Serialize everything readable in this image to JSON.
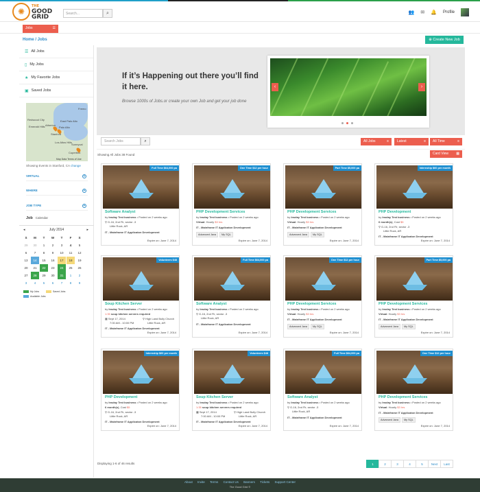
{
  "logo": {
    "the": "THE",
    "good": "GOOD",
    "grid": "GRID"
  },
  "header": {
    "search_placeholder": "Search...",
    "profile_label": "Profile",
    "icons": [
      "users-icon",
      "envelope-icon",
      "bell-icon"
    ]
  },
  "subbar": {
    "jobs_dropdown": "Jobs"
  },
  "breadcrumb": "Home / Jobs",
  "create_button": "Create New Job",
  "sidebar": {
    "nav": [
      {
        "label": "All Jobs",
        "icon": "list-icon"
      },
      {
        "label": "My Jobs",
        "icon": "file-icon"
      },
      {
        "label": "My Favorite Jobs",
        "icon": "star-icon"
      },
      {
        "label": "Saved Jobs",
        "icon": "save-icon"
      }
    ],
    "map_cities": [
      "Redwood City",
      "Palo Alto",
      "Stanford",
      "Los Altos Hills",
      "Sunnyval",
      "Cupertino",
      "East Palo Alto",
      "Atherton",
      "Emerald Hills",
      "Fremo"
    ],
    "map_credit": "Map Data   Terms of Use",
    "showing_text": "Showing Events in Stanford, CA",
    "change_link": "change",
    "filters": [
      "VIRTUAL",
      "WHERE",
      "JOB TYPE"
    ],
    "job_label": "Job",
    "calendar_tab": "Calendar",
    "calendar": {
      "month": "July 2014",
      "days": [
        "S",
        "M",
        "T",
        "W",
        "T",
        "F",
        "S"
      ],
      "weeks": [
        [
          "29",
          "30",
          "1",
          "2",
          "3",
          "4",
          "5"
        ],
        [
          "6",
          "7",
          "8",
          "9",
          "10",
          "11",
          "12"
        ],
        [
          "13",
          "14",
          "15",
          "16",
          "17",
          "18",
          "19"
        ],
        [
          "20",
          "21",
          "22",
          "23",
          "24",
          "25",
          "26"
        ],
        [
          "27",
          "28",
          "29",
          "30",
          "31",
          "1",
          "2"
        ],
        [
          "3",
          "4",
          "5",
          "6",
          "7",
          "8",
          "9"
        ]
      ],
      "legend": [
        "My Jobs",
        "Saved Jobs",
        "Available Jobs"
      ],
      "colors": {
        "my_jobs": "#3ba54a",
        "saved_jobs": "#f5d97a",
        "available_jobs": "#5aa9db"
      }
    }
  },
  "hero": {
    "heading": "If it’s Happening out there you’ll find it here.",
    "subtext": "Browse 1000s of Jobs.or create your own Job and get your job done"
  },
  "controls": {
    "search_placeholder": "Search Jobs",
    "all_jobs": "All Jobs",
    "latest": "Latest",
    "all_time": "All Time",
    "count_text": "Showing All Jobs   38 Found",
    "card_view": "Card View"
  },
  "cards": [
    {
      "ribbon": "Full Time $64,000 pa",
      "title": "Software Analyst",
      "business": "Insday Test business",
      "posted": "Posted on 2 weeks ago",
      "l1": "G-16, 2nd Flr, sector -3",
      "l2": "Little Rock, AR",
      "skills": "IT - Mainframe   IT Applicaton Development",
      "expire": "Expire on: June 7, 2014"
    },
    {
      "ribbon": "One Time $12 per hour",
      "title": "PHP Development Services",
      "business": "Insday Test business",
      "posted": "Posted on 2 weeks ago",
      "l1": "Virtual",
      "l1b": "Hourly",
      "l1c": "$3 hrs",
      "skills": "IT - Mainframe   IT Applicaton Development",
      "tags": [
        "Advanced Java",
        "My SQL"
      ],
      "expire": "Expire on: June 7, 2014"
    },
    {
      "ribbon": "Part Time $5,000 pa",
      "title": "PHP Development Services",
      "business": "Insday Test business",
      "posted": "Posted on 2 weeks ago",
      "l1": "Virtual",
      "l1b": "Hourly",
      "l1c": "$3 hrs",
      "skills": "IT - Mainframe   IT Applicaton Development",
      "tags": [
        "Advanced Java",
        "My SQL"
      ],
      "expire": "Expire on: June 7, 2014"
    },
    {
      "ribbon": "Internship $60 per month",
      "title": "PHP Development",
      "business": "Insday Test business",
      "posted": "Posted on 2 weeks ago",
      "l1": "6 month(s)",
      "l1b": "Cost",
      "l1c": "$5",
      "l2": "G-16, 2nd Flr, sector -3",
      "l3": "Little Rock, AR",
      "skills": "IT - Mainframe   IT Applicaton Development",
      "expire": "Expire on: June 7, 2014"
    },
    {
      "ribbon": "Volunteers  $48",
      "title": "Soup Kitchen Server",
      "business": "Insday Test business",
      "posted": "Posted on 2 weeks ago",
      "l1": "1:35",
      "l1b": "soup kitchen servers required",
      "d1": "Sept 17, 2014",
      "d2": "7:00 AM - 10:00 PM",
      "p1": "High Land Bully Church",
      "p2": "Little Rock, AR",
      "skills": "IT - Mainframe   IT Applicaton Development",
      "expire": "Expire on: June 7, 2014"
    },
    {
      "ribbon": "Full Time $64,000 pa",
      "title": "Software Analyst",
      "business": "Insday Test business",
      "posted": "Posted on 2 weeks ago",
      "l1": "G-16, 2nd Flr, sector -3",
      "l2": "Little Rock, AR",
      "skills": "IT - Mainframe   IT Applicaton Development",
      "expire": "Expire on: June 7, 2014"
    },
    {
      "ribbon": "One Time $12 per hour",
      "title": "PHP Development Services",
      "business": "Insday Test business",
      "posted": "Posted on 2 weeks ago",
      "l1": "Virtual",
      "l1b": "Hourly",
      "l1c": "$3 hrs",
      "skills": "IT - Mainframe   IT Applicaton Development",
      "tags": [
        "Advanced Java",
        "My SQL"
      ],
      "expire": "Expire on: June 7, 2014"
    },
    {
      "ribbon": "Part Time $5,000 pa",
      "title": "PHP Development Services",
      "business": "Insday Test business",
      "posted": "Posted on 2 weeks ago",
      "l1": "Virtual",
      "l1b": "Hourly",
      "l1c": "$3 hrs",
      "skills": "IT - Mainframe   IT Applicaton Development",
      "tags": [
        "Advanced Java",
        "My SQL"
      ],
      "expire": "Expire on: June 7, 2014"
    },
    {
      "ribbon": "Internship $60 per month",
      "title": "PHP Development",
      "business": "Insday Test business",
      "posted": "Posted on 2 weeks ago",
      "l1": "6 month(s)",
      "l1b": "Cost",
      "l1c": "$5",
      "l2": "G-16, 2nd Flr, sector -3",
      "l3": "Little Rock, AR",
      "skills": "IT - Mainframe   IT Applicaton Development",
      "expire": "Expire on: June 7, 2014"
    },
    {
      "ribbon": "Volunteers  $48",
      "title": "Soup Kitchen Server",
      "business": "Insday Test business",
      "posted": "Posted on 2 weeks ago",
      "l1": "1:35",
      "l1b": "soup kitchen servers required",
      "d1": "Sept 17, 2014",
      "d2": "7:00 AM - 10:00 PM",
      "p1": "High Land Bully Church",
      "p2": "Little Rock, AR",
      "skills": "IT - Mainframe   IT Applicaton Development",
      "expire": "Expire on: June 7, 2014"
    },
    {
      "ribbon": "Full Time $64,000 pa",
      "title": "Software Analyst",
      "business": "Insday Test business",
      "posted": "Posted on 2 weeks ago",
      "l1": "G-16, 2nd Flr, sector -3",
      "l2": "Little Rock, AR",
      "skills": "IT - Mainframe   IT Applicaton Development",
      "expire": "Expire on: June 7, 2014"
    },
    {
      "ribbon": "One Time $12 per hour",
      "title": "PHP Development Services",
      "business": "Insday Test business",
      "posted": "Posted on 2 weeks ago",
      "l1": "Virtual",
      "l1b": "Hourly",
      "l1c": "$3 hrs",
      "skills": "IT - Mainframe   IT Applicaton Development",
      "tags": [
        "Advanced Java",
        "My SQL"
      ],
      "expire": "Expire on: June 7, 2014"
    }
  ],
  "results": "Displaying 1-6 of 46 results",
  "pagination": [
    "1",
    "2",
    "3",
    "4",
    "5",
    "Next",
    "Last"
  ],
  "footer": {
    "links": [
      "About",
      "Invite",
      "Terms",
      "Contact Us",
      "Banners",
      "Tickets",
      "Support Center"
    ],
    "copyright": "The Good Grid ©"
  },
  "colors": {
    "accent": "#ec5e4e",
    "teal": "#25b89c",
    "link": "#2a8bc8",
    "ribbon": "#1f8fd0",
    "footer": "#2f3d34"
  }
}
